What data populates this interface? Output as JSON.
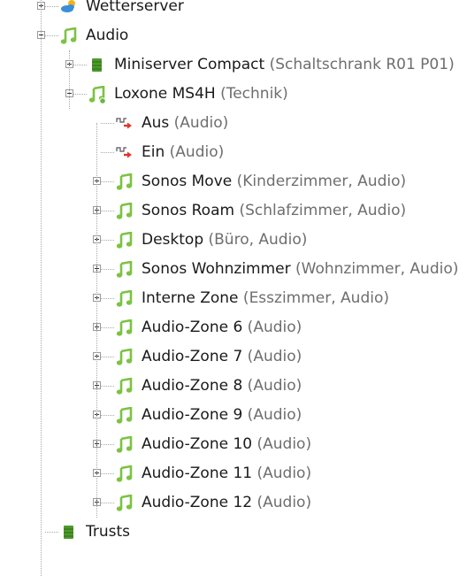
{
  "tree": [
    {
      "name": "Wetterserver",
      "meta": "",
      "icon": "weather-icon",
      "level": 1,
      "expander": "closed"
    },
    {
      "name": "Audio",
      "meta": "",
      "icon": "music-note-icon",
      "level": 1,
      "expander": "open"
    },
    {
      "name": "Miniserver Compact",
      "meta": " (Schaltschrank R01 P01)",
      "icon": "miniserver-icon",
      "level": 2,
      "expander": "closed"
    },
    {
      "name": "Loxone MS4H",
      "meta": " (Technik)",
      "icon": "music-note-online-icon",
      "level": 2,
      "expander": "open"
    },
    {
      "name": "Aus",
      "meta": " (Audio)",
      "icon": "digital-output-icon",
      "level": 3,
      "expander": "none"
    },
    {
      "name": "Ein",
      "meta": " (Audio)",
      "icon": "digital-output-icon",
      "level": 3,
      "expander": "none"
    },
    {
      "name": "Sonos Move",
      "meta": " (Kinderzimmer, Audio)",
      "icon": "music-note-icon",
      "level": 3,
      "expander": "closed"
    },
    {
      "name": "Sonos Roam",
      "meta": " (Schlafzimmer, Audio)",
      "icon": "music-note-icon",
      "level": 3,
      "expander": "closed"
    },
    {
      "name": "Desktop",
      "meta": " (Büro, Audio)",
      "icon": "music-note-icon",
      "level": 3,
      "expander": "closed"
    },
    {
      "name": "Sonos Wohnzimmer",
      "meta": " (Wohnzimmer, Audio)",
      "icon": "music-note-icon",
      "level": 3,
      "expander": "closed"
    },
    {
      "name": "Interne Zone",
      "meta": " (Esszimmer, Audio)",
      "icon": "music-note-icon",
      "level": 3,
      "expander": "closed"
    },
    {
      "name": "Audio-Zone 6",
      "meta": " (Audio)",
      "icon": "music-note-icon",
      "level": 3,
      "expander": "closed"
    },
    {
      "name": "Audio-Zone 7",
      "meta": " (Audio)",
      "icon": "music-note-icon",
      "level": 3,
      "expander": "closed"
    },
    {
      "name": "Audio-Zone 8",
      "meta": " (Audio)",
      "icon": "music-note-icon",
      "level": 3,
      "expander": "closed"
    },
    {
      "name": "Audio-Zone 9",
      "meta": " (Audio)",
      "icon": "music-note-icon",
      "level": 3,
      "expander": "closed"
    },
    {
      "name": "Audio-Zone 10",
      "meta": " (Audio)",
      "icon": "music-note-icon",
      "level": 3,
      "expander": "closed"
    },
    {
      "name": "Audio-Zone 11",
      "meta": " (Audio)",
      "icon": "music-note-icon",
      "level": 3,
      "expander": "closed"
    },
    {
      "name": "Audio-Zone 12",
      "meta": " (Audio)",
      "icon": "music-note-icon",
      "level": 3,
      "expander": "closed"
    },
    {
      "name": "Trusts",
      "meta": "",
      "icon": "miniserver-icon",
      "level": 1,
      "expander": "none"
    }
  ],
  "colors": {
    "note_green": "#7cc243",
    "miniserver_green": "#4d9a2a",
    "status_online": "#69b646",
    "output_red": "#e0342a",
    "meta_gray": "#6e6e6e"
  }
}
